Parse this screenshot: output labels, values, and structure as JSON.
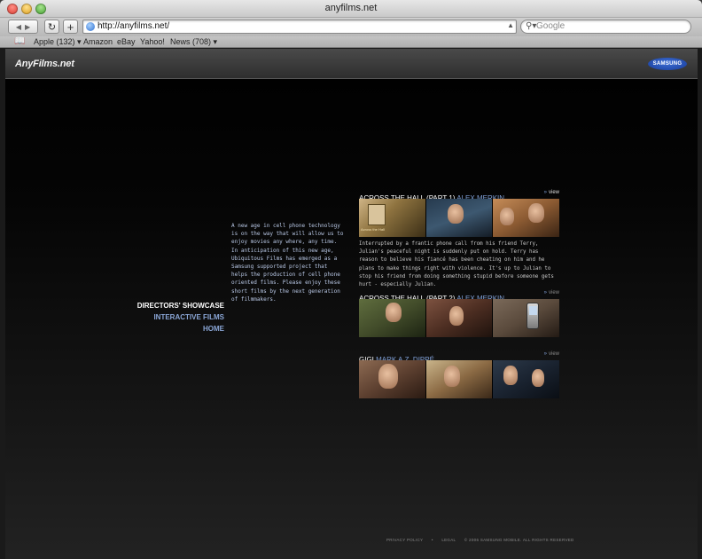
{
  "browser": {
    "window_title": "anyfilms.net",
    "address": "http://anyfilms.net/",
    "search_placeholder": "Google",
    "bookmarks": [
      "Apple (132) ▾",
      "Amazon",
      "eBay",
      "Yahoo!",
      "News (708) ▾"
    ]
  },
  "site": {
    "logo": "AnyFilms.net",
    "sponsor_logo": "SAMSUNG",
    "nav": [
      "DIRECTORS' SHOWCASE",
      "INTERACTIVE FILMS",
      "HOME"
    ],
    "intro": "A new age in cell phone technology is on the way that will allow us to enjoy movies any where, any time. In anticipation of this new age, Ubiquitous Films has emerged as a Samsung supported project that helps the production of cell phone oriented films. Please enjoy these short films by the next generation of filmmakers.",
    "films": [
      {
        "title": "ACROSS THE HALL (PART 1)",
        "director": "ALEX MERKIN",
        "view": "view",
        "thumb_caption": "Across the Hall",
        "description": "Interrupted by a frantic phone call from his friend Terry, Julian's peaceful night is suddenly put on hold. Terry has reason to believe his fiancé has been cheating on him and he plans to make things right with violence. It's up to Julian to stop his friend from doing something stupid before someone gets hurt - especially Julian."
      },
      {
        "title": "ACROSS THE HALL (PART 2)",
        "director": "ALEX MERKIN",
        "view": "view"
      },
      {
        "title": "GIGI",
        "director": "MARK A.Z. DIPPÉ",
        "view": "view"
      }
    ],
    "footer": [
      "PRIVACY POLICY",
      "•",
      "LEGAL",
      "© 2006 SAMSUNG MOBILE. ALL RIGHTS RESERVED"
    ]
  }
}
